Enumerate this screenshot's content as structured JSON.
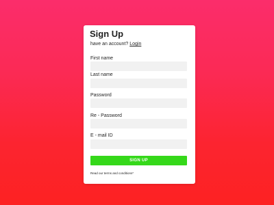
{
  "form": {
    "title": "Sign Up",
    "have_account_text": "have an account?",
    "login_link": "Login",
    "fields": [
      {
        "label": "First name",
        "value": ""
      },
      {
        "label": "Last name",
        "value": ""
      },
      {
        "label": "Password",
        "value": ""
      },
      {
        "label": "Re - Password",
        "value": ""
      },
      {
        "label": "E - mail ID",
        "value": ""
      }
    ],
    "submit_label": "SIGN UP",
    "terms_text": "Read our terms and conditions*"
  },
  "colors": {
    "background_top": "#fb2d6b",
    "background_bottom": "#fd2222",
    "card": "#ffffff",
    "input_bg": "#f1f1f1",
    "submit_bg": "#35d81a"
  }
}
